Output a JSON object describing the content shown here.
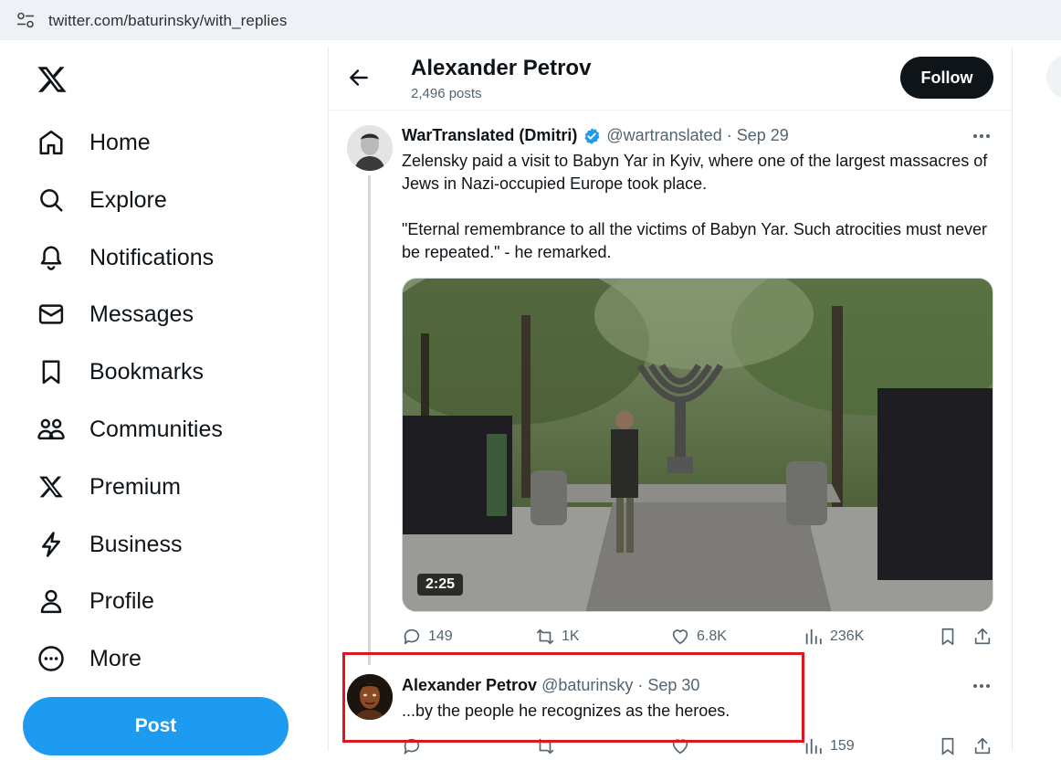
{
  "browser": {
    "url": "twitter.com/baturinsky/with_replies"
  },
  "nav": {
    "items": [
      {
        "label": "Home",
        "icon": "home-icon"
      },
      {
        "label": "Explore",
        "icon": "search-icon"
      },
      {
        "label": "Notifications",
        "icon": "bell-icon"
      },
      {
        "label": "Messages",
        "icon": "envelope-icon"
      },
      {
        "label": "Bookmarks",
        "icon": "bookmark-icon"
      },
      {
        "label": "Communities",
        "icon": "people-icon"
      },
      {
        "label": "Premium",
        "icon": "x-logo-icon"
      },
      {
        "label": "Business",
        "icon": "lightning-icon"
      },
      {
        "label": "Profile",
        "icon": "person-icon"
      },
      {
        "label": "More",
        "icon": "more-circle-icon"
      }
    ],
    "post_label": "Post"
  },
  "header": {
    "name": "Alexander Petrov",
    "posts": "2,496 posts",
    "follow_label": "Follow"
  },
  "tweet1": {
    "author": "WarTranslated (Dmitri)",
    "handle": "@wartranslated",
    "date": "Sep 29",
    "meta": "@wartranslated · Sep 29",
    "text": "Zelensky paid a visit to Babyn Yar in Kyiv, where one of the largest massacres of Jews in Nazi-occupied Europe took place.\n\n\"Eternal remembrance to all the victims of Babyn Yar. Such atrocities must never be repeated.\" - he remarked.",
    "video_duration": "2:25",
    "replies": "149",
    "reposts": "1K",
    "likes": "6.8K",
    "views": "236K"
  },
  "tweet2": {
    "author": "Alexander Petrov",
    "meta": "@baturinsky · Sep 30",
    "text": "...by the people he recognizes as the heroes.",
    "views": "159"
  },
  "colors": {
    "accent": "#1d9bf0",
    "highlight": "#e0161e",
    "text": "#0f1419",
    "muted": "#536471"
  }
}
